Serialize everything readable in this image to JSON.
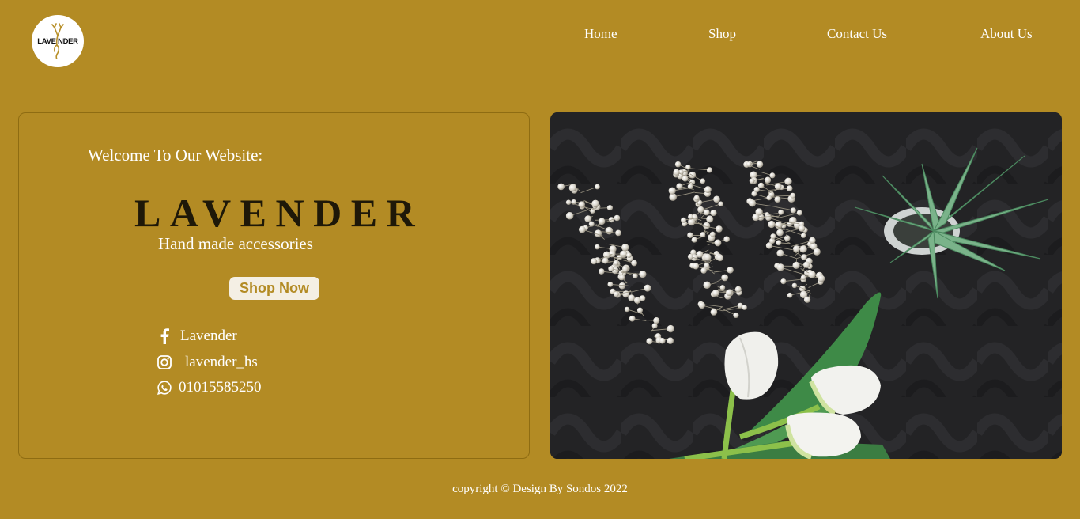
{
  "header": {
    "logo_text": "LAVE  NDER",
    "nav": [
      "Home",
      "Shop",
      "Contact Us",
      "About Us"
    ]
  },
  "hero_card": {
    "welcome": "Welcome To Our Website:",
    "brand": "LAVENDER",
    "tagline": "Hand made accessories",
    "cta_label": "Shop Now",
    "social": {
      "facebook": "Lavender",
      "instagram": "lavender_hs",
      "whatsapp": "01015585250"
    }
  },
  "hero_image": {
    "subject": "pearl hair vines on black fabric with white tulips and a succulent"
  },
  "footer": {
    "copyright": "copyright © Design By Sondos 2022"
  },
  "colors": {
    "background": "#b38b24",
    "brand_text": "#1e1808",
    "button_bg": "#f4efe4",
    "text": "#ffffff"
  },
  "icons": [
    "facebook-icon",
    "instagram-icon",
    "whatsapp-icon",
    "deer-logo-icon"
  ]
}
